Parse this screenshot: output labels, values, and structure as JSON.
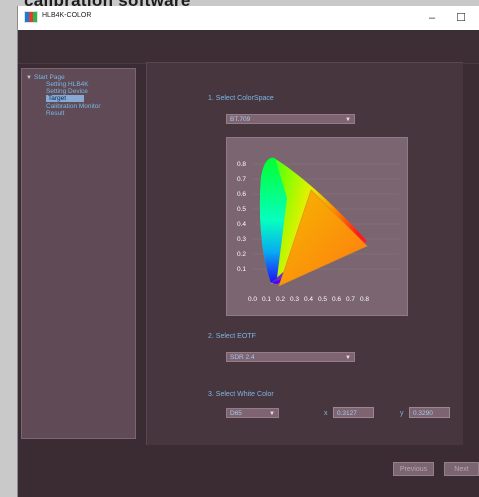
{
  "caption": "calibration software",
  "window": {
    "title": "HLB4K-COLOR",
    "minimize_symbol": "–",
    "maximize_symbol": "☐"
  },
  "tree": {
    "items": [
      {
        "label": "Start Page"
      },
      {
        "label": "Setting HLB4K"
      },
      {
        "label": "Setting Device"
      },
      {
        "label": "Target",
        "selected": true
      },
      {
        "label": "Calibration Monitor"
      },
      {
        "label": "Result"
      }
    ]
  },
  "steps": {
    "colorspace": {
      "label": "1. Select ColorSpace",
      "value": "BT.709"
    },
    "eotf": {
      "label": "2. Select EOTF",
      "value": "SDR 2.4"
    },
    "white": {
      "label": "3. Select White Color",
      "value": "D65",
      "x_label": "x",
      "x_value": "0.3127",
      "y_label": "y",
      "y_value": "0.3290"
    }
  },
  "cie_chart": {
    "y_ticks": [
      "0.8",
      "0.7",
      "0.6",
      "0.5",
      "0.4",
      "0.3",
      "0.2",
      "0.1"
    ],
    "x_ticks": [
      "0.0",
      "0.1",
      "0.2",
      "0.3",
      "0.4",
      "0.5",
      "0.6",
      "0.7",
      "0.8"
    ]
  },
  "buttons": {
    "previous": "Previous",
    "next": "Next"
  },
  "colors": {
    "background": "#3a2c32",
    "accent_text": "#7db5e3",
    "selection": "#88a9d3"
  }
}
